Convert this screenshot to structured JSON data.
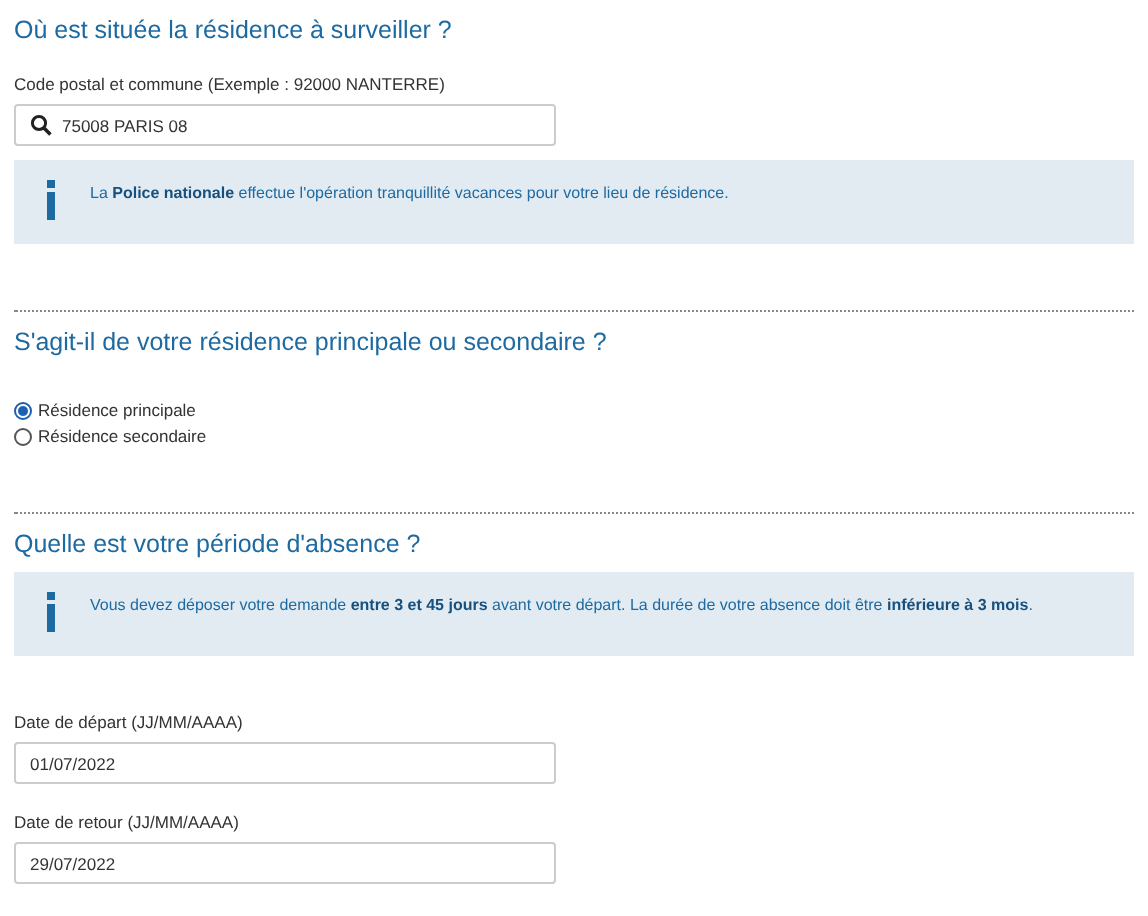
{
  "sections": [
    {
      "title": "Où est située la résidence à surveiller ?",
      "items": [
        {
          "kind": "search",
          "label": "Code postal et commune (Exemple : 92000 NANTERRE)",
          "value": "75008 PARIS 08"
        },
        {
          "kind": "info",
          "text": "La **Police nationale** effectue l'opération tranquillité vacances pour votre lieu de résidence."
        }
      ]
    },
    {
      "title": "S'agit-il de votre résidence principale ou secondaire ?",
      "items": [
        {
          "kind": "radios",
          "options": [
            {
              "label": "Résidence principale",
              "selected": true
            },
            {
              "label": "Résidence secondaire",
              "selected": false
            }
          ]
        }
      ]
    },
    {
      "title": "Quelle est votre période d'absence ?",
      "items": [
        {
          "kind": "info",
          "text": "Vous devez déposer votre demande **entre 3 et 45 jours** avant votre départ. La durée de votre absence doit être **inférieure à 3 mois**."
        },
        {
          "kind": "date",
          "label": "Date de départ (JJ/MM/AAAA)",
          "value": "01/07/2022"
        },
        {
          "kind": "date",
          "label": "Date de retour (JJ/MM/AAAA)",
          "value": "29/07/2022"
        }
      ]
    }
  ]
}
